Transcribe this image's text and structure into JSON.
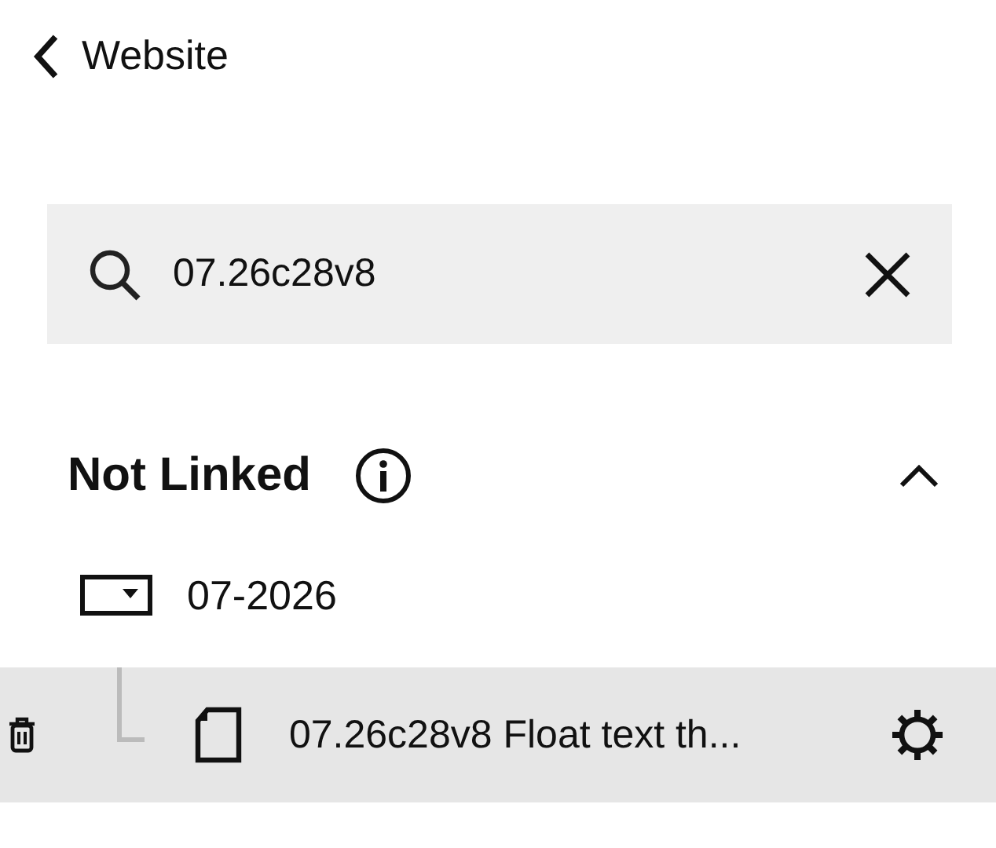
{
  "header": {
    "back_label": "Website"
  },
  "search": {
    "value": "07.26c28v8"
  },
  "section": {
    "title": "Not Linked",
    "expanded": true,
    "folders": [
      {
        "label": "07-2026",
        "children": [
          {
            "label": "07.26c28v8 Float text th...",
            "selected": true
          }
        ]
      }
    ]
  }
}
